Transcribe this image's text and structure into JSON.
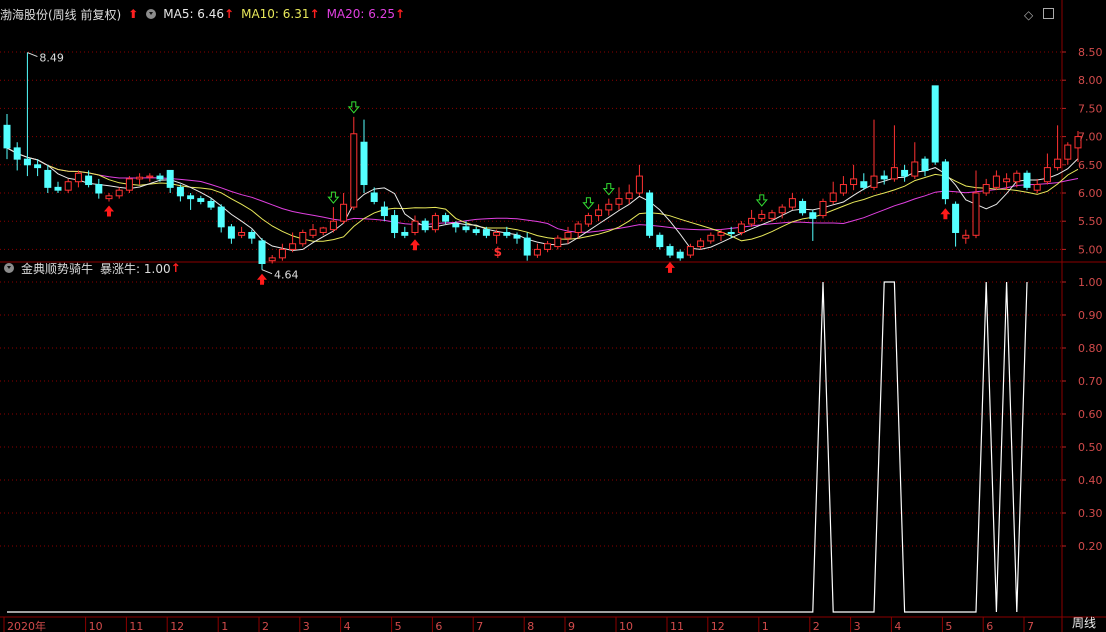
{
  "header": {
    "stock_title": "渤海股份(周线 前复权)",
    "ma5_label": "MA5: 6.46",
    "ma10_label": "MA10: 6.31",
    "ma20_label": "MA20: 6.25",
    "up_arrow": "↑",
    "big_up": "⬆"
  },
  "indicator": {
    "title": "金典顺势骑牛",
    "value_label": "暴涨牛: 1.00",
    "up_arrow": "↑"
  },
  "period_label": "周线",
  "colors": {
    "up": "#ff3232",
    "down": "#54ffff",
    "ma5": "#e8e8e8",
    "ma10": "#e8e85a",
    "ma20": "#e040e0",
    "grid": "#8b0000",
    "signal_up": "#ff1a1a",
    "signal_down": "#33dd33",
    "indicator_line": "#ffffff"
  },
  "chart_data": [
    {
      "type": "candlestick",
      "title": "渤海股份(周线 前复权)",
      "y_ticks": [
        "8.50",
        "8.00",
        "7.50",
        "7.00",
        "6.50",
        "6.00",
        "5.50",
        "5.00"
      ],
      "ylim": [
        4.5,
        8.9
      ],
      "annotations": {
        "high_label": "8.49",
        "low_label": "4.64"
      },
      "candles": [
        [
          7.2,
          7.4,
          6.6,
          6.8
        ],
        [
          6.8,
          6.9,
          6.4,
          6.6
        ],
        [
          6.6,
          8.49,
          6.3,
          6.5
        ],
        [
          6.5,
          6.6,
          6.3,
          6.45
        ],
        [
          6.4,
          6.5,
          6.0,
          6.1
        ],
        [
          6.1,
          6.2,
          6.0,
          6.05
        ],
        [
          6.05,
          6.25,
          6.0,
          6.2
        ],
        [
          6.2,
          6.4,
          6.1,
          6.35
        ],
        [
          6.3,
          6.4,
          6.1,
          6.15
        ],
        [
          6.15,
          6.25,
          5.9,
          6.0
        ],
        [
          5.9,
          6.0,
          5.85,
          5.95
        ],
        [
          5.95,
          6.1,
          5.9,
          6.05
        ],
        [
          6.05,
          6.3,
          6.0,
          6.25
        ],
        [
          6.25,
          6.35,
          6.15,
          6.28
        ],
        [
          6.28,
          6.35,
          6.2,
          6.3
        ],
        [
          6.3,
          6.35,
          6.2,
          6.25
        ],
        [
          6.4,
          6.4,
          6.0,
          6.1
        ],
        [
          6.1,
          6.15,
          5.85,
          5.95
        ],
        [
          5.95,
          6.0,
          5.7,
          5.9
        ],
        [
          5.9,
          5.95,
          5.8,
          5.85
        ],
        [
          5.85,
          5.9,
          5.7,
          5.75
        ],
        [
          5.75,
          5.8,
          5.3,
          5.4
        ],
        [
          5.4,
          5.45,
          5.1,
          5.2
        ],
        [
          5.25,
          5.4,
          5.2,
          5.3
        ],
        [
          5.3,
          5.35,
          5.1,
          5.2
        ],
        [
          5.15,
          5.2,
          4.64,
          4.75
        ],
        [
          4.8,
          4.9,
          4.75,
          4.85
        ],
        [
          4.85,
          5.1,
          4.8,
          5.0
        ],
        [
          5.0,
          5.3,
          4.95,
          5.1
        ],
        [
          5.1,
          5.35,
          5.05,
          5.3
        ],
        [
          5.25,
          5.45,
          5.2,
          5.35
        ],
        [
          5.3,
          5.4,
          5.25,
          5.38
        ],
        [
          5.35,
          5.75,
          5.3,
          5.5
        ],
        [
          5.5,
          6.0,
          5.45,
          5.8
        ],
        [
          5.75,
          7.35,
          5.7,
          7.05
        ],
        [
          6.9,
          7.3,
          6.0,
          6.15
        ],
        [
          6.0,
          6.1,
          5.8,
          5.85
        ],
        [
          5.75,
          5.85,
          5.5,
          5.6
        ],
        [
          5.6,
          5.7,
          5.2,
          5.3
        ],
        [
          5.3,
          5.4,
          5.2,
          5.25
        ],
        [
          5.3,
          5.6,
          5.25,
          5.5
        ],
        [
          5.5,
          5.55,
          5.3,
          5.35
        ],
        [
          5.35,
          5.65,
          5.3,
          5.6
        ],
        [
          5.6,
          5.65,
          5.45,
          5.5
        ],
        [
          5.45,
          5.5,
          5.3,
          5.4
        ],
        [
          5.4,
          5.5,
          5.3,
          5.35
        ],
        [
          5.35,
          5.4,
          5.25,
          5.3
        ],
        [
          5.35,
          5.4,
          5.2,
          5.25
        ],
        [
          5.25,
          5.35,
          5.1,
          5.3
        ],
        [
          5.3,
          5.4,
          5.2,
          5.25
        ],
        [
          5.25,
          5.3,
          5.1,
          5.2
        ],
        [
          5.2,
          5.3,
          4.8,
          4.9
        ],
        [
          4.9,
          5.1,
          4.85,
          5.0
        ],
        [
          5.0,
          5.15,
          4.95,
          5.1
        ],
        [
          5.05,
          5.25,
          5.0,
          5.2
        ],
        [
          5.2,
          5.4,
          5.1,
          5.3
        ],
        [
          5.3,
          5.5,
          5.2,
          5.45
        ],
        [
          5.45,
          5.65,
          5.4,
          5.6
        ],
        [
          5.6,
          5.8,
          5.5,
          5.7
        ],
        [
          5.7,
          5.9,
          5.6,
          5.8
        ],
        [
          5.8,
          6.1,
          5.7,
          5.9
        ],
        [
          5.9,
          6.15,
          5.8,
          6.0
        ],
        [
          6.0,
          6.5,
          5.95,
          6.3
        ],
        [
          6.0,
          6.05,
          5.2,
          5.25
        ],
        [
          5.25,
          5.3,
          5.0,
          5.05
        ],
        [
          5.05,
          5.1,
          4.85,
          4.9
        ],
        [
          4.95,
          5.0,
          4.8,
          4.85
        ],
        [
          4.9,
          5.1,
          4.85,
          5.05
        ],
        [
          5.05,
          5.2,
          5.0,
          5.15
        ],
        [
          5.15,
          5.3,
          5.1,
          5.25
        ],
        [
          5.25,
          5.35,
          5.15,
          5.3
        ],
        [
          5.3,
          5.4,
          5.2,
          5.28
        ],
        [
          5.3,
          5.5,
          5.25,
          5.45
        ],
        [
          5.45,
          5.7,
          5.4,
          5.55
        ],
        [
          5.55,
          5.7,
          5.5,
          5.62
        ],
        [
          5.55,
          5.7,
          5.5,
          5.65
        ],
        [
          5.65,
          5.8,
          5.55,
          5.75
        ],
        [
          5.75,
          6.0,
          5.7,
          5.9
        ],
        [
          5.85,
          5.9,
          5.6,
          5.65
        ],
        [
          5.65,
          5.7,
          5.15,
          5.55
        ],
        [
          5.6,
          5.9,
          5.55,
          5.85
        ],
        [
          5.85,
          6.2,
          5.8,
          6.0
        ],
        [
          6.0,
          6.3,
          5.95,
          6.15
        ],
        [
          6.15,
          6.5,
          6.05,
          6.25
        ],
        [
          6.2,
          6.35,
          6.05,
          6.1
        ],
        [
          6.1,
          7.3,
          6.05,
          6.3
        ],
        [
          6.3,
          6.4,
          6.15,
          6.25
        ],
        [
          6.25,
          7.2,
          6.2,
          6.45
        ],
        [
          6.4,
          6.5,
          6.2,
          6.3
        ],
        [
          6.3,
          6.9,
          6.25,
          6.55
        ],
        [
          6.6,
          6.65,
          6.3,
          6.4
        ],
        [
          7.9,
          7.9,
          6.5,
          6.55
        ],
        [
          6.55,
          6.6,
          5.8,
          5.9
        ],
        [
          5.8,
          5.85,
          5.05,
          5.3
        ],
        [
          5.2,
          5.35,
          5.1,
          5.25
        ],
        [
          5.25,
          6.4,
          5.2,
          6.0
        ],
        [
          6.0,
          6.25,
          5.95,
          6.15
        ],
        [
          6.1,
          6.4,
          6.05,
          6.3
        ],
        [
          6.2,
          6.35,
          6.05,
          6.25
        ],
        [
          6.2,
          6.4,
          6.1,
          6.35
        ],
        [
          6.35,
          6.4,
          6.05,
          6.1
        ],
        [
          6.05,
          6.25,
          6.0,
          6.15
        ],
        [
          6.2,
          6.7,
          6.15,
          6.45
        ],
        [
          6.45,
          7.2,
          6.4,
          6.6
        ],
        [
          6.6,
          6.9,
          6.5,
          6.85
        ],
        [
          6.8,
          7.1,
          6.55,
          7.0
        ]
      ],
      "signals": [
        {
          "index": 10,
          "dir": "up"
        },
        {
          "index": 25,
          "dir": "up"
        },
        {
          "index": 32,
          "dir": "down"
        },
        {
          "index": 34,
          "dir": "down"
        },
        {
          "index": 40,
          "dir": "up"
        },
        {
          "index": 57,
          "dir": "down"
        },
        {
          "index": 59,
          "dir": "down"
        },
        {
          "index": 65,
          "dir": "up"
        },
        {
          "index": 74,
          "dir": "down"
        },
        {
          "index": 92,
          "dir": "up"
        }
      ],
      "s_marker": {
        "index": 48,
        "label": "$"
      }
    },
    {
      "type": "line",
      "title": "金典顺势骑牛",
      "series_name": "暴涨牛",
      "y_ticks": [
        "1.00",
        "0.90",
        "0.80",
        "0.70",
        "0.60",
        "0.50",
        "0.40",
        "0.30",
        "0.20"
      ],
      "ylim": [
        0,
        1.0
      ],
      "values": [
        0,
        0,
        0,
        0,
        0,
        0,
        0,
        0,
        0,
        0,
        0,
        0,
        0,
        0,
        0,
        0,
        0,
        0,
        0,
        0,
        0,
        0,
        0,
        0,
        0,
        0,
        0,
        0,
        0,
        0,
        0,
        0,
        0,
        0,
        0,
        0,
        0,
        0,
        0,
        0,
        0,
        0,
        0,
        0,
        0,
        0,
        0,
        0,
        0,
        0,
        0,
        0,
        0,
        0,
        0,
        0,
        0,
        0,
        0,
        0,
        0,
        0,
        0,
        0,
        0,
        0,
        0,
        0,
        0,
        0,
        0,
        0,
        0,
        0,
        0,
        0,
        0,
        0,
        0,
        0,
        1,
        0,
        0,
        0,
        0,
        0,
        1,
        1,
        0,
        0,
        0,
        0,
        0,
        0,
        0,
        0,
        1,
        0,
        1,
        0,
        1
      ]
    }
  ],
  "x_axis": {
    "labels": [
      {
        "index": 0,
        "text": "2020年"
      },
      {
        "index": 8,
        "text": "10"
      },
      {
        "index": 12,
        "text": "11"
      },
      {
        "index": 16,
        "text": "12"
      },
      {
        "index": 21,
        "text": "1"
      },
      {
        "index": 25,
        "text": "2"
      },
      {
        "index": 29,
        "text": "3"
      },
      {
        "index": 33,
        "text": "4"
      },
      {
        "index": 38,
        "text": "5"
      },
      {
        "index": 42,
        "text": "6"
      },
      {
        "index": 46,
        "text": "7"
      },
      {
        "index": 51,
        "text": "8"
      },
      {
        "index": 55,
        "text": "9"
      },
      {
        "index": 60,
        "text": "10"
      },
      {
        "index": 65,
        "text": "11"
      },
      {
        "index": 69,
        "text": "12"
      },
      {
        "index": 74,
        "text": "1"
      },
      {
        "index": 79,
        "text": "2"
      },
      {
        "index": 83,
        "text": "3"
      },
      {
        "index": 87,
        "text": "4"
      },
      {
        "index": 92,
        "text": "5"
      },
      {
        "index": 96,
        "text": "6"
      },
      {
        "index": 100,
        "text": "7"
      }
    ]
  }
}
